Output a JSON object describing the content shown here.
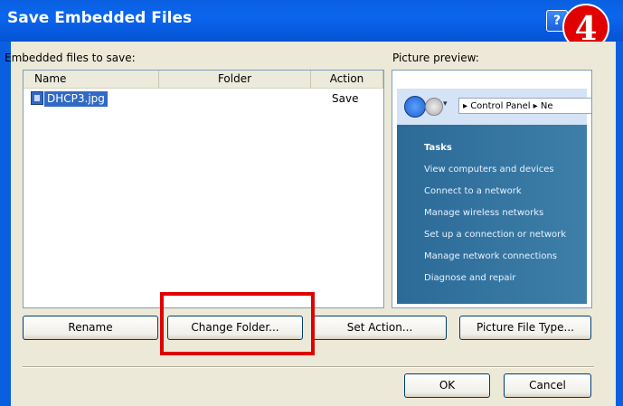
{
  "window": {
    "title": "Save Embedded Files",
    "help_label": "?",
    "step_badge": "4"
  },
  "list": {
    "label": "Embedded files to save:",
    "columns": [
      "Name",
      "Folder",
      "Action"
    ],
    "rows": [
      {
        "name": "DHCP3.jpg",
        "folder": "",
        "action": "Save",
        "icon": "jpg-file-icon"
      }
    ]
  },
  "preview": {
    "label": "Picture preview:",
    "breadcrumb": "▸ Control Panel ▸ Ne",
    "tasks_heading": "Tasks",
    "items": [
      "View computers and devices",
      "Connect to a network",
      "Manage wireless networks",
      "Set up a connection or network",
      "Manage network connections",
      "Diagnose and repair"
    ]
  },
  "buttons": {
    "rename": "Rename",
    "change_folder": "Change Folder...",
    "set_action": "Set Action...",
    "picture_file_type": "Picture File Type...",
    "ok": "OK",
    "cancel": "Cancel"
  },
  "colors": {
    "titlebar": "#0a5fe0",
    "highlight": "#e00000",
    "selection": "#316ac5"
  }
}
